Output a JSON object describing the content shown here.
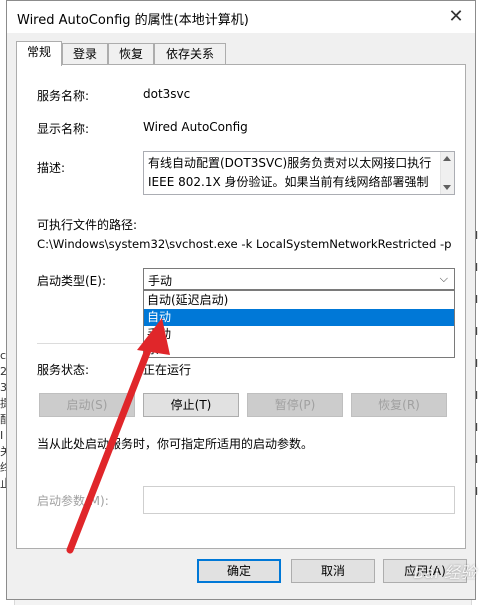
{
  "window": {
    "title": "Wired AutoConfig 的属性(本地计算机)",
    "close_glyph": "✕"
  },
  "tabs": [
    {
      "label": "常规",
      "active": true
    },
    {
      "label": "登录",
      "active": false
    },
    {
      "label": "恢复",
      "active": false
    },
    {
      "label": "依存关系",
      "active": false
    }
  ],
  "general": {
    "service_name_label": "服务名称:",
    "service_name": "dot3svc",
    "display_name_label": "显示名称:",
    "display_name": "Wired AutoConfig",
    "description_label": "描述:",
    "description": "有线自动配置(DOT3SVC)服务负责对以太网接口执行 IEEE 802.1X 身份验证。如果当前有线网络部署强制执",
    "exe_path_label": "可执行文件的路径:",
    "exe_path": "C:\\Windows\\system32\\svchost.exe -k LocalSystemNetworkRestricted -p",
    "startup_type_label": "启动类型(E):",
    "startup_type_value": "手动",
    "startup_options": [
      {
        "label": "自动(延迟启动)",
        "selected": false
      },
      {
        "label": "自动",
        "selected": true
      },
      {
        "label": "手动",
        "selected": false
      },
      {
        "label": "禁",
        "selected": false
      }
    ],
    "service_status_label": "服务状态:",
    "service_status_value": "正在运行",
    "buttons": {
      "start": "启动(S)",
      "stop": "停止(T)",
      "pause": "暂停(P)",
      "resume": "恢复(R)"
    },
    "hint": "当从此处启动服务时，你可指定所适用的启动参数。",
    "start_params_label": "启动参数(M):",
    "start_params_value": ""
  },
  "footer": {
    "ok": "确定",
    "cancel": "取消",
    "apply": "应用(A)"
  },
  "background": {
    "left_fragments": [
      "c)",
      "2",
      "3",
      "提",
      "配",
      "I",
      "关",
      "终",
      "止"
    ],
    "right_fragments": [
      "Ⅰ",
      "Ⅰ",
      "Ⅰ",
      "Ⅰ",
      "Ⅰ",
      "Ⅰ",
      "Ⅰ",
      "Ⅰ",
      "Ⅰ"
    ]
  },
  "watermark": "Bai 经验",
  "colors": {
    "selection": "#0078d7",
    "annotation_arrow": "#e0262a"
  }
}
